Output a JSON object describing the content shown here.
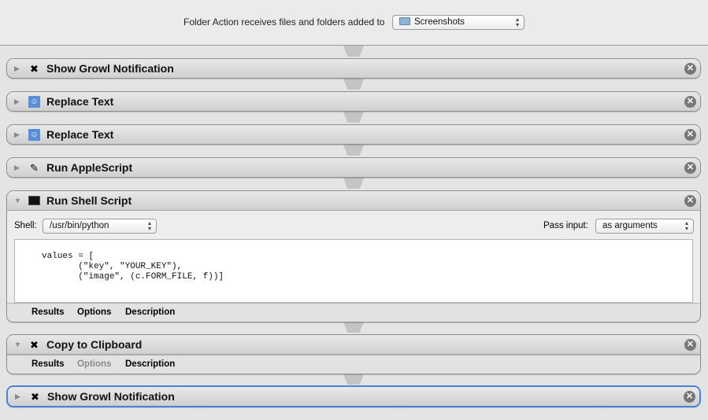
{
  "header": {
    "label": "Folder Action receives files and folders added to",
    "folder": "Screenshots"
  },
  "actions": [
    {
      "title": "Show Growl Notification",
      "icon": "automator-tools-icon"
    },
    {
      "title": "Replace Text",
      "icon": "finder-icon"
    },
    {
      "title": "Replace Text",
      "icon": "finder-icon"
    },
    {
      "title": "Run AppleScript",
      "icon": "applescript-icon"
    },
    {
      "title": "Run Shell Script",
      "icon": "terminal-icon",
      "shell_label": "Shell:",
      "shell": "/usr/bin/python",
      "pass_label": "Pass input:",
      "pass": "as arguments",
      "code": "values = [\n       (\"key\", \"YOUR_KEY\"),\n       (\"image\", (c.FORM_FILE, f))]"
    },
    {
      "title": "Copy to Clipboard",
      "icon": "automator-tools-icon"
    },
    {
      "title": "Show Growl Notification",
      "icon": "automator-tools-icon"
    }
  ],
  "footer": {
    "results": "Results",
    "options": "Options",
    "description": "Description"
  }
}
